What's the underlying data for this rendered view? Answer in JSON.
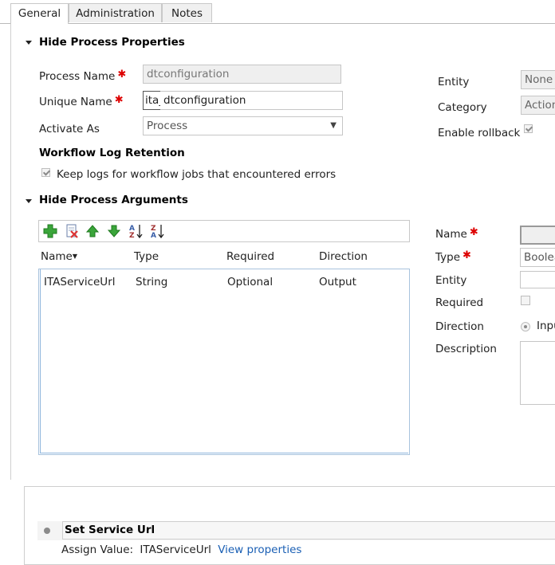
{
  "tabs": [
    "General",
    "Administration",
    "Notes"
  ],
  "process_properties": {
    "header": "Hide Process Properties",
    "process_name_label": "Process Name",
    "process_name_value": "dtconfiguration",
    "unique_name_label": "Unique Name",
    "unique_name_prefix": "ita_",
    "unique_name_value": "dtconfiguration",
    "activate_as_label": "Activate As",
    "activate_as_value": "Process",
    "entity_label": "Entity",
    "entity_value": "None (",
    "category_label": "Category",
    "category_value": "Action",
    "enable_rollback_label": "Enable rollback",
    "log_retention_header": "Workflow Log Retention",
    "keep_logs_label": "Keep logs for workflow jobs that encountered errors"
  },
  "process_arguments": {
    "header": "Hide Process Arguments",
    "columns": [
      "Name",
      "Type",
      "Required",
      "Direction"
    ],
    "rows": [
      {
        "name": "ITAServiceUrl",
        "type": "String",
        "required": "Optional",
        "direction": "Output"
      }
    ],
    "detail": {
      "name_label": "Name",
      "type_label": "Type",
      "type_value": "Boolea",
      "entity_label": "Entity",
      "required_label": "Required",
      "direction_label": "Direction",
      "direction_value": "Inpu",
      "description_label": "Description"
    }
  },
  "step": {
    "title": "Set Service Url",
    "assign_label": "Assign Value:",
    "assign_value": "ITAServiceUrl",
    "view_link": "View properties"
  },
  "icons": [
    "add-icon",
    "delete-icon",
    "move-up-icon",
    "move-down-icon",
    "sort-ascending-icon",
    "sort-descending-icon",
    "required-asterisk-icon",
    "dropdown-arrow-icon"
  ],
  "colors": {
    "required": "#dd0000",
    "link": "#1a5fb4",
    "grid_border": "#8fb6dd"
  }
}
